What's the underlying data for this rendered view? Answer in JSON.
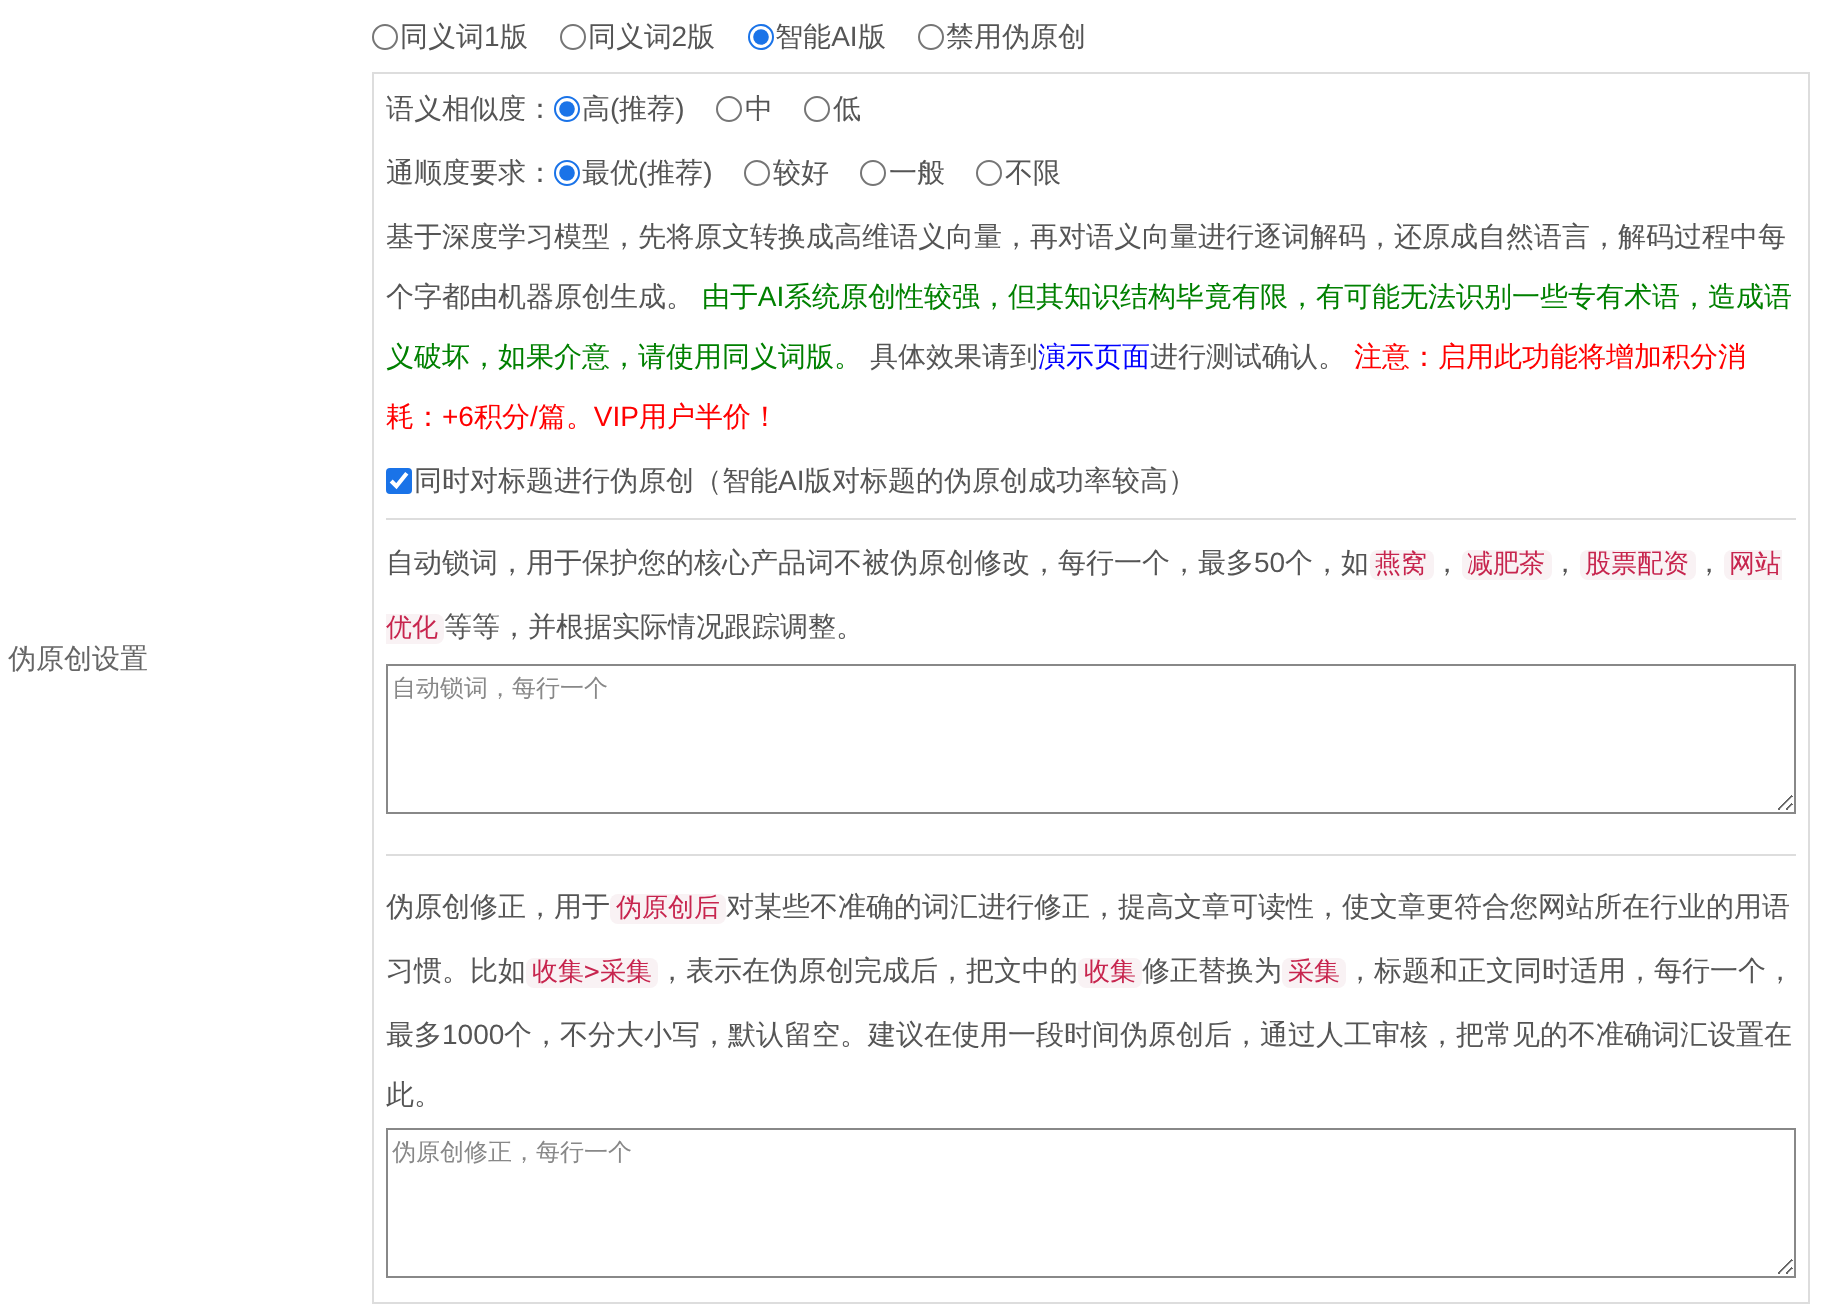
{
  "section_label": "伪原创设置",
  "modes": [
    {
      "label": "同义词1版",
      "selected": false
    },
    {
      "label": "同义词2版",
      "selected": false
    },
    {
      "label": "智能AI版",
      "selected": true
    },
    {
      "label": "禁用伪原创",
      "selected": false
    }
  ],
  "ai_settings": {
    "options": [
      {
        "label": "语义相似度：",
        "choices": [
          {
            "label": "高(推荐)",
            "selected": true
          },
          {
            "label": "中",
            "selected": false
          },
          {
            "label": "低",
            "selected": false
          }
        ]
      },
      {
        "label": "通顺度要求：",
        "choices": [
          {
            "label": "最优(推荐)",
            "selected": true
          },
          {
            "label": "较好",
            "selected": false
          },
          {
            "label": "一般",
            "selected": false
          },
          {
            "label": "不限",
            "selected": false
          }
        ]
      }
    ],
    "description": [
      {
        "kind": "text",
        "text": "基于深度学习模型，先将原文转换成高维语义向量，再对语义向量进行逐词解码，还原成自然语言，解码过程中每个字都由机器原创生成。 "
      },
      {
        "kind": "green",
        "text": "由于AI系统原创性较强，但其知识结构毕竟有限，有可能无法识别一些专有术语，造成语义破坏，如果介意，请使用同义词版。"
      },
      {
        "kind": "text",
        "text": " 具体效果请到"
      },
      {
        "kind": "link",
        "text": "演示页面"
      },
      {
        "kind": "text",
        "text": "进行测试确认。 "
      },
      {
        "kind": "red",
        "text": "注意：启用此功能将增加积分消耗：+6积分/篇。VIP用户半价！"
      }
    ],
    "title_option": {
      "label": "同时对标题进行伪原创（智能AI版对标题的伪原创成功率较高）",
      "checked": true
    }
  },
  "lock_words": {
    "description": [
      {
        "kind": "text",
        "text": "自动锁词，用于保护您的核心产品词不被伪原创修改，每行一个，最多50个，如"
      },
      {
        "kind": "code",
        "text": "燕窝"
      },
      {
        "kind": "text",
        "text": "，"
      },
      {
        "kind": "code",
        "text": "减肥茶"
      },
      {
        "kind": "text",
        "text": "，"
      },
      {
        "kind": "code",
        "text": "股票配资"
      },
      {
        "kind": "text",
        "text": "，"
      },
      {
        "kind": "code",
        "text": "网站优化"
      },
      {
        "kind": "text",
        "text": "等等，并根据实际情况跟踪调整。"
      }
    ],
    "placeholder": "自动锁词，每行一个"
  },
  "corrections": {
    "description": [
      {
        "kind": "text",
        "text": "伪原创修正，用于"
      },
      {
        "kind": "code",
        "text": "伪原创后"
      },
      {
        "kind": "text",
        "text": "对某些不准确的词汇进行修正，提高文章可读性，使文章更符合您网站所在行业的用语习惯。比如"
      },
      {
        "kind": "code",
        "text": "收集>采集"
      },
      {
        "kind": "text",
        "text": "，表示在伪原创完成后，把文中的"
      },
      {
        "kind": "code",
        "text": "收集"
      },
      {
        "kind": "text",
        "text": "修正替换为"
      },
      {
        "kind": "code",
        "text": "采集"
      },
      {
        "kind": "text",
        "text": "，标题和正文同时适用，每行一个，最多1000个，不分大小写，默认留空。建议在使用一段时间伪原创后，通过人工审核，把常见的不准确词汇设置在此。"
      }
    ],
    "placeholder": "伪原创修正，每行一个"
  }
}
